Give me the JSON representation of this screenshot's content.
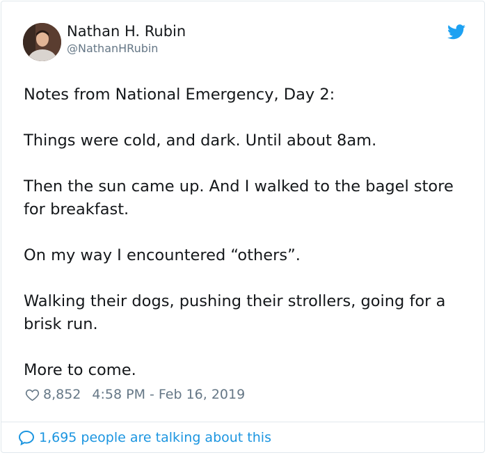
{
  "tweet": {
    "author_name": "Nathan H. Rubin",
    "author_handle": "@NathanHRubin",
    "paragraphs": [
      "Notes from National Emergency, Day 2:",
      "Things were cold, and dark. Until about 8am.",
      "Then the sun came up. And I walked to the bagel store for breakfast.",
      "On my way I encountered “others”.",
      "Walking their dogs, pushing their strollers, going for a brisk run.",
      "More to come."
    ],
    "like_count": "8,852",
    "timestamp": "4:58 PM - Feb 16, 2019",
    "conversation_link": "1,695 people are talking about this"
  },
  "icons": {
    "brand": "twitter-bird-icon",
    "like": "heart-icon",
    "conversation": "speech-bubble-icon"
  },
  "colors": {
    "accent": "#1da1f2",
    "link": "#1b95e0",
    "secondary_text": "#657786",
    "border": "#e1e8ed"
  }
}
